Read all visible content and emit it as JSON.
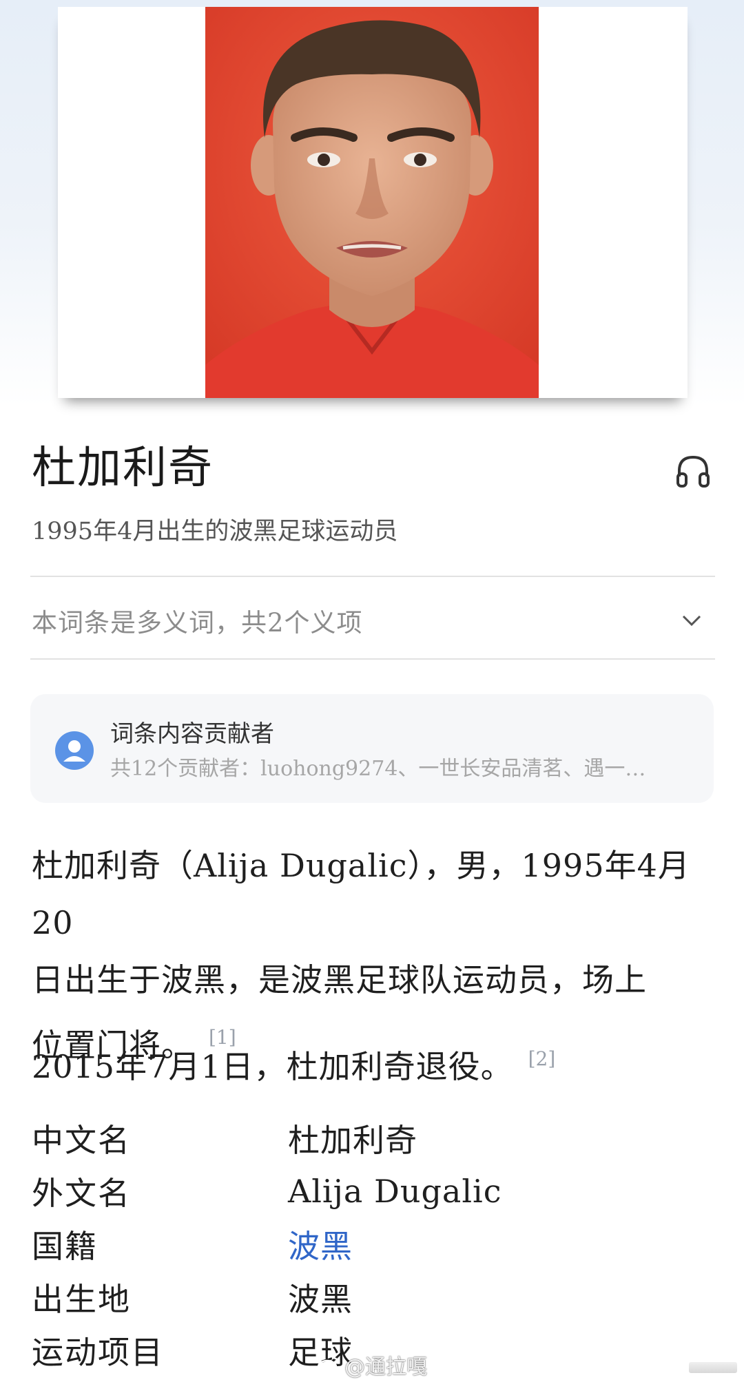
{
  "entry": {
    "title": "杜加利奇",
    "subtitle": "1995年4月出生的波黑足球运动员"
  },
  "polysemy": {
    "label": "本词条是多义词，共2个义项"
  },
  "contributors": {
    "title": "词条内容贡献者",
    "description": "共12个贡献者：luohong9274、一世长安品清茗、遇一…"
  },
  "summary": {
    "line1": "杜加利奇（Alija Dugalic），男，1995年4月20",
    "line2": "日出生于波黑，是波黑足球队运动员，场上",
    "line3": "位置门将。",
    "cite1": "[1]",
    "paragraph2": "2015年7月1日，杜加利奇退役。",
    "cite2": "[2]"
  },
  "infobox": [
    {
      "key": "中文名",
      "value": "杜加利奇"
    },
    {
      "key": "外文名",
      "value": "Alija Dugalic"
    },
    {
      "key": "国籍",
      "value": "波黑"
    },
    {
      "key": "出生地",
      "value": "波黑"
    },
    {
      "key": "运动项目",
      "value": "足球"
    }
  ],
  "watermark": {
    "text": "@通拉嘎"
  },
  "colors": {
    "link": "#3066c8",
    "portrait_background": "#e0452f",
    "muted_text": "#8c8c8c",
    "avatar": "#5b93e6"
  }
}
